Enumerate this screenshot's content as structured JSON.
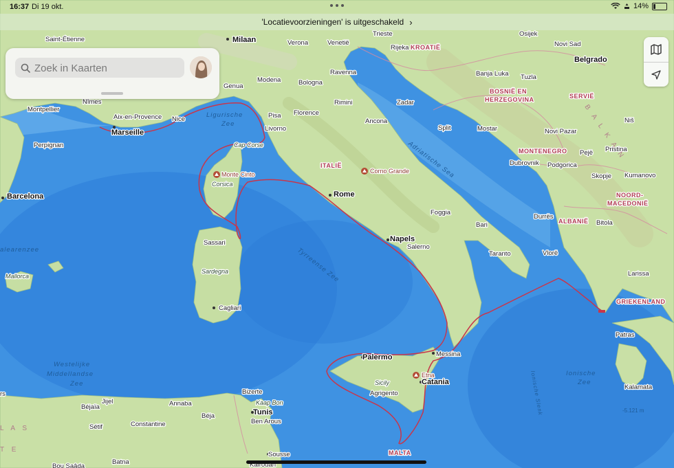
{
  "status_bar": {
    "time": "16:37",
    "date": "Di 19 okt.",
    "battery": "14%"
  },
  "banner": {
    "text": "'Locatievoorzieningen' is uitgeschakeld"
  },
  "search": {
    "placeholder": "Zoek in Kaarten"
  },
  "map": {
    "cities": {
      "saint_etienne": "Saint-Étienne",
      "milaan": "Milaan",
      "verona": "Verona",
      "venetie": "Venetië",
      "trieste": "Trieste",
      "rijeka": "Rijeka",
      "osijek": "Osijek",
      "novi_sad": "Novi Sad",
      "belgrado": "Belgrado",
      "genua": "Genua",
      "modena": "Modena",
      "bologna": "Bologna",
      "ravenna": "Ravenna",
      "banja_luka": "Banja Luka",
      "tuzla": "Tuzla",
      "montpellier": "Montpellier",
      "nimes": "Nîmes",
      "aix": "Aix-en-Provence",
      "nice": "Nice",
      "marseille": "Marseille",
      "pisa": "Pisa",
      "florence": "Florence",
      "rimini": "Rimini",
      "zadar": "Zadar",
      "livorno": "Livorno",
      "ancona": "Ancona",
      "split": "Split",
      "mostar": "Mostar",
      "novi_pazar": "Novi Pazar",
      "nis": "Niš",
      "perpignan": "Perpignan",
      "pristina": "Pristina",
      "dubrovnik": "Dubrovnik",
      "podgorica": "Podgorica",
      "pejie": "Pejë",
      "skopje": "Skopje",
      "kumanovo": "Kumanovo",
      "barcelona": "Barcelona",
      "rome": "Rome",
      "foggia": "Foggia",
      "bari": "Bari",
      "durres": "Durrës",
      "bitola": "Bitola",
      "sassari": "Sassari",
      "napels": "Napels",
      "salerno": "Salerno",
      "taranto": "Taranto",
      "vlore": "Vlorë",
      "larissa": "Larissa",
      "cagliari": "Cagliari",
      "patras": "Patras",
      "messina": "Messina",
      "palermo": "Palermo",
      "catania": "Catania",
      "agrigento": "Agrigento",
      "kalamata": "Kalamata",
      "bizerte": "Bizerte",
      "bejaia": "Béjaïa",
      "jijel": "Jijel",
      "annaba": "Annaba",
      "tunis": "Tunis",
      "setif": "Sétif",
      "constantine": "Constantine",
      "beja": "Béja",
      "ben_arous": "Ben Arous",
      "batna": "Batna",
      "sousse": "Sousse",
      "kairouan": "Kairouan",
      "bou_saada": "Bou Saâda",
      "olbia_frag": "rs"
    },
    "countries": {
      "kroatie": "KROATIË",
      "bosnie_1": "BOSNIË EN",
      "bosnie_2": "HERZEGOVINA",
      "servie": "SERVIË",
      "italie": "ITALIË",
      "montenegro": "MONTENEGRO",
      "noord_1": "NOORD-",
      "noord_2": "MACEDONIË",
      "albanie": "ALBANIË",
      "griekenland": "GRIEKENLAND",
      "malta": "MALTA"
    },
    "regions": {
      "balkan": "B A L K A N",
      "las": "L A S",
      "te": "T E"
    },
    "seas": {
      "ligurische_1": "Ligurische",
      "ligurische_2": "Zee",
      "adriatische": "Adriatische Sea",
      "tyrreense": "Tyrreense Zee",
      "balearen": "alearenzee",
      "westelijke_1": "Westelijke",
      "westelijke_2": "Middellandse",
      "westelijke_3": "Zee",
      "ionische_1": "Ionische",
      "ionische_2": "Zee",
      "ionische_v": "Ionische Slenk"
    },
    "islands": {
      "corsica": "Corsica",
      "sardegna": "Sardegna",
      "sicily": "Sicily",
      "mallorca": "Mallorca",
      "cap_corse": "Cap Corse",
      "kaap_bon": "Kaap Bon"
    },
    "pois": {
      "monte_cinto": "Monte Cinto",
      "corno_grande": "Corno Grande",
      "etna": "Etna"
    },
    "depth": "-5.121 m"
  },
  "colors": {
    "sea": "#3d8fe0",
    "land": "#c8dfa4",
    "route": "#c9354a",
    "country_label": "#b03c52",
    "sea_label": "#1e5c9a"
  }
}
